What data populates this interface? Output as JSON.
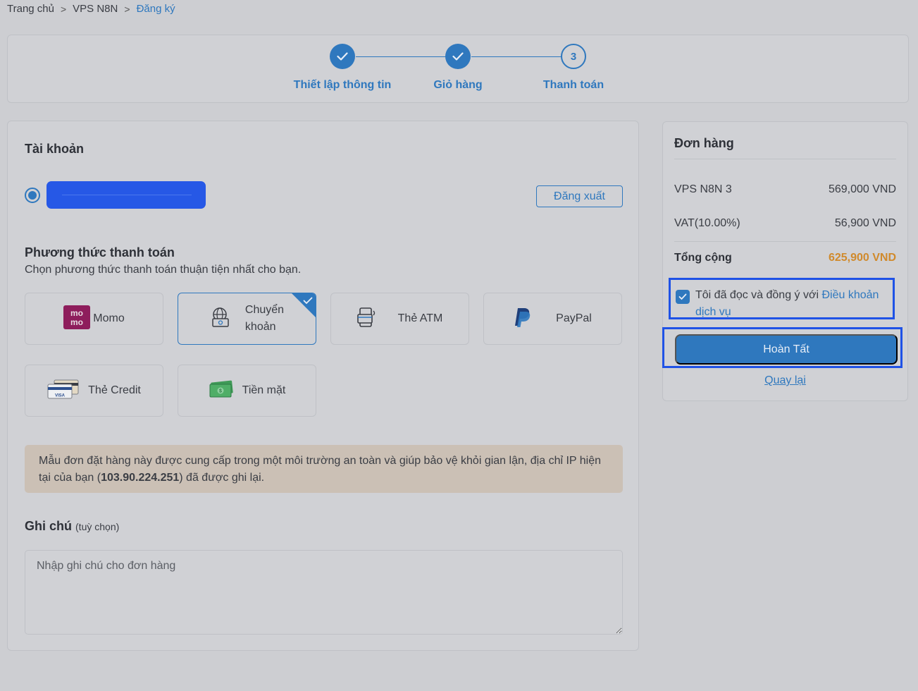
{
  "breadcrumb": {
    "home": "Trang chủ",
    "product": "VPS N8N",
    "current": "Đăng ký"
  },
  "stepper": {
    "steps": [
      {
        "label": "Thiết lập thông tin",
        "state": "done"
      },
      {
        "label": "Giỏ hàng",
        "state": "done"
      },
      {
        "label": "Thanh toán",
        "state": "current",
        "number": "3"
      }
    ]
  },
  "account": {
    "title": "Tài khoản",
    "logout_label": "Đăng xuất"
  },
  "payment": {
    "title": "Phương thức thanh toán",
    "subtitle": "Chọn phương thức thanh toán thuận tiện nhất cho bạn.",
    "methods": [
      {
        "label": "Momo",
        "icon": "momo-logo-icon",
        "selected": false
      },
      {
        "label_line1": "Chuyển",
        "label_line2": "khoản",
        "icon": "bank-transfer-icon",
        "selected": true
      },
      {
        "label": "Thẻ ATM",
        "icon": "atm-card-icon",
        "selected": false
      },
      {
        "label": "PayPal",
        "icon": "paypal-logo-icon",
        "selected": false
      },
      {
        "label": "Thẻ Credit",
        "icon": "credit-card-icon",
        "selected": false
      },
      {
        "label": "Tiền mặt",
        "icon": "cash-icon",
        "selected": false
      }
    ]
  },
  "notice": {
    "text_before": "Mẫu đơn đặt hàng này được cung cấp trong một môi trường an toàn và giúp bảo vệ khỏi gian lận, địa chỉ IP hiện tại của bạn (",
    "ip": "103.90.224.251",
    "text_after": ") đã được ghi lại."
  },
  "note": {
    "title": "Ghi chú",
    "optional": "(tuỳ chọn)",
    "placeholder": "Nhập ghi chú cho đơn hàng"
  },
  "order": {
    "title": "Đơn hàng",
    "items": [
      {
        "name": "VPS N8N 3",
        "amount": "569,000 VND"
      },
      {
        "name": "VAT(10.00%)",
        "amount": "56,900 VND"
      }
    ],
    "total": {
      "label": "Tổng cộng",
      "amount": "625,900 VND"
    },
    "terms_text": "Tôi đã đọc và đồng ý với ",
    "terms_link": "Điều khoản dịch vụ",
    "submit_label": "Hoàn Tất",
    "back_label": "Quay lại"
  },
  "colors": {
    "accent": "#2f78be",
    "total": "#d08a2c",
    "highlight": "#1f52e6"
  }
}
